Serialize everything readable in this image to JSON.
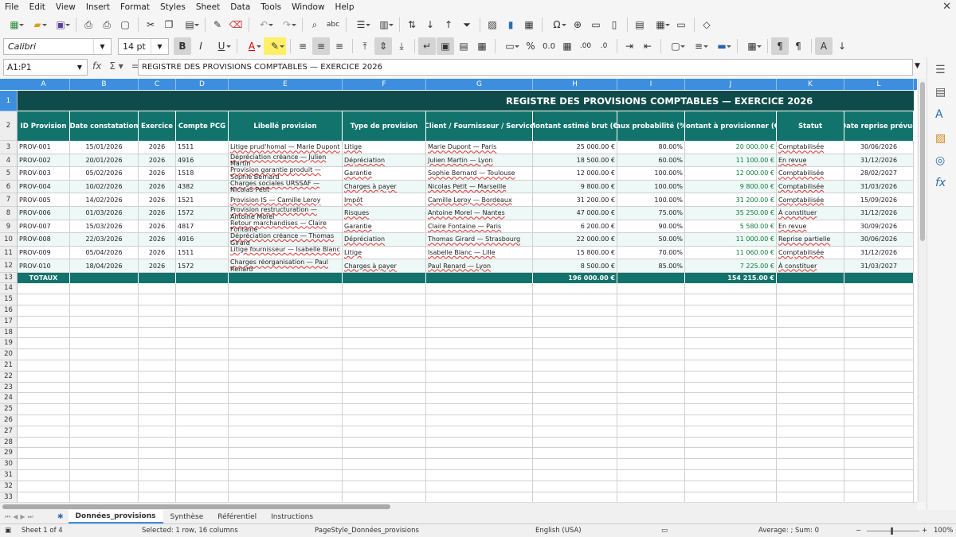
{
  "menu": [
    "File",
    "Edit",
    "View",
    "Insert",
    "Format",
    "Styles",
    "Sheet",
    "Data",
    "Tools",
    "Window",
    "Help"
  ],
  "toolbar": {
    "font_name": "Calibri",
    "font_size": "14 pt"
  },
  "formula_bar": {
    "name_box": "A1:P1",
    "content": "REGISTRE DES PROVISIONS COMPTABLES — EXERCICE 2026"
  },
  "columns": [
    "A",
    "B",
    "C",
    "D",
    "E",
    "F",
    "G",
    "H",
    "I",
    "J",
    "K",
    "L"
  ],
  "title": "REGISTRE DES PROVISIONS COMPTABLES — EXERCICE 2026",
  "headers": [
    "ID Provision",
    "Date constatation",
    "Exercice",
    "Compte PCG",
    "Libellé provision",
    "Type de provision",
    "Client / Fournisseur / Service",
    "Montant estimé brut (€)",
    "Taux probabilité (%)",
    "Montant à provisionner (€)",
    "Statut",
    "Date reprise prévue"
  ],
  "rows": [
    [
      "PROV-001",
      "15/01/2026",
      "2026",
      "1511",
      "Litige prud'homal — Marie Dupont",
      "Litige",
      "Marie Dupont — Paris",
      "25 000.00 €",
      "80.00%",
      "20 000.00 €",
      "Comptabilisée",
      "30/06/2026"
    ],
    [
      "PROV-002",
      "20/01/2026",
      "2026",
      "4916",
      "Dépréciation créance — Julien Martin",
      "Dépréciation",
      "Julien Martin — Lyon",
      "18 500.00 €",
      "60.00%",
      "11 100.00 €",
      "En revue",
      "31/12/2026"
    ],
    [
      "PROV-003",
      "05/02/2026",
      "2026",
      "1518",
      "Provision garantie produit — Sophie Bernard",
      "Garantie",
      "Sophie Bernard — Toulouse",
      "12 000.00 €",
      "100.00%",
      "12 000.00 €",
      "Comptabilisée",
      "28/02/2027"
    ],
    [
      "PROV-004",
      "10/02/2026",
      "2026",
      "4382",
      "Charges sociales URSSAF — Nicolas Petit",
      "Charges à payer",
      "Nicolas Petit — Marseille",
      "9 800.00 €",
      "100.00%",
      "9 800.00 €",
      "Comptabilisée",
      "31/03/2026"
    ],
    [
      "PROV-005",
      "14/02/2026",
      "2026",
      "1521",
      "Provision IS — Camille Leroy",
      "Impôt",
      "Camille Leroy — Bordeaux",
      "31 200.00 €",
      "100.00%",
      "31 200.00 €",
      "Comptabilisée",
      "15/09/2026"
    ],
    [
      "PROV-006",
      "01/03/2026",
      "2026",
      "1572",
      "Provision restructuration — Antoine Morel",
      "Risques",
      "Antoine Morel — Nantes",
      "47 000.00 €",
      "75.00%",
      "35 250.00 €",
      "À constituer",
      "31/12/2026"
    ],
    [
      "PROV-007",
      "15/03/2026",
      "2026",
      "4817",
      "Retour marchandises — Claire Fontaine",
      "Garantie",
      "Claire Fontaine — Paris",
      "6 200.00 €",
      "90.00%",
      "5 580.00 €",
      "En revue",
      "30/09/2026"
    ],
    [
      "PROV-008",
      "22/03/2026",
      "2026",
      "4916",
      "Dépréciation créance — Thomas Girard",
      "Dépréciation",
      "Thomas Girard — Strasbourg",
      "22 000.00 €",
      "50.00%",
      "11 000.00 €",
      "Reprise partielle",
      "30/06/2026"
    ],
    [
      "PROV-009",
      "05/04/2026",
      "2026",
      "1511",
      "Litige fournisseur — Isabelle Blanc",
      "Litige",
      "Isabelle Blanc — Lille",
      "15 800.00 €",
      "70.00%",
      "11 060.00 €",
      "Comptabilisée",
      "31/12/2026"
    ],
    [
      "PROV-010",
      "18/04/2026",
      "2026",
      "1572",
      "Charges réorganisation — Paul Renard",
      "Charges à payer",
      "Paul Renard — Lyon",
      "8 500.00 €",
      "85.00%",
      "7 225.00 €",
      "À constituer",
      "31/03/2027"
    ]
  ],
  "totals": {
    "label": "TOTAUX",
    "gross": "196 000.00 €",
    "provision": "154 215.00 €"
  },
  "sheet_tabs": [
    "Données_provisions",
    "Synthèse",
    "Référentiel",
    "Instructions"
  ],
  "active_tab": "Données_provisions",
  "status": {
    "sheet": "Sheet 1 of 4",
    "selection": "Selected: 1 row, 16 columns",
    "page_style": "PageStyle_Données_provisions",
    "language": "English (USA)",
    "summary": "Average: ; Sum: 0",
    "zoom": "100%"
  },
  "colors": {
    "accent": "#3d8ede",
    "title_band": "#0e4b4a",
    "header_band": "#11736c",
    "green_cell": "#dff5df"
  }
}
